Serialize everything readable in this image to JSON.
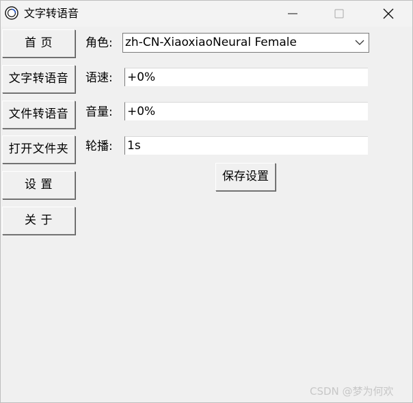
{
  "window": {
    "title": "文字转语音",
    "icon": "app-ring-icon",
    "controls": {
      "minimize_icon": "minimize-icon",
      "maximize_icon": "maximize-icon",
      "close_icon": "close-icon"
    }
  },
  "sidebar": {
    "items": [
      {
        "label": "首 页"
      },
      {
        "label": "文字转语音"
      },
      {
        "label": "文件转语音"
      },
      {
        "label": "打开文件夹"
      },
      {
        "label": "设 置"
      },
      {
        "label": "关 于"
      }
    ]
  },
  "settings": {
    "role": {
      "label": "角色:",
      "value": "zh-CN-XiaoxiaoNeural Female",
      "icon": "chevron-down-icon"
    },
    "rate": {
      "label": "语速:",
      "value": "+0%"
    },
    "volume": {
      "label": "音量:",
      "value": "+0%"
    },
    "interval": {
      "label": "轮播:",
      "value": "1s"
    },
    "save_label": "保存设置"
  },
  "watermark": "CSDN @梦为何欢",
  "colors": {
    "background": "#f0f0f0",
    "field_bg": "#ffffff",
    "text": "#000000",
    "watermark": "#c7c7c7"
  }
}
